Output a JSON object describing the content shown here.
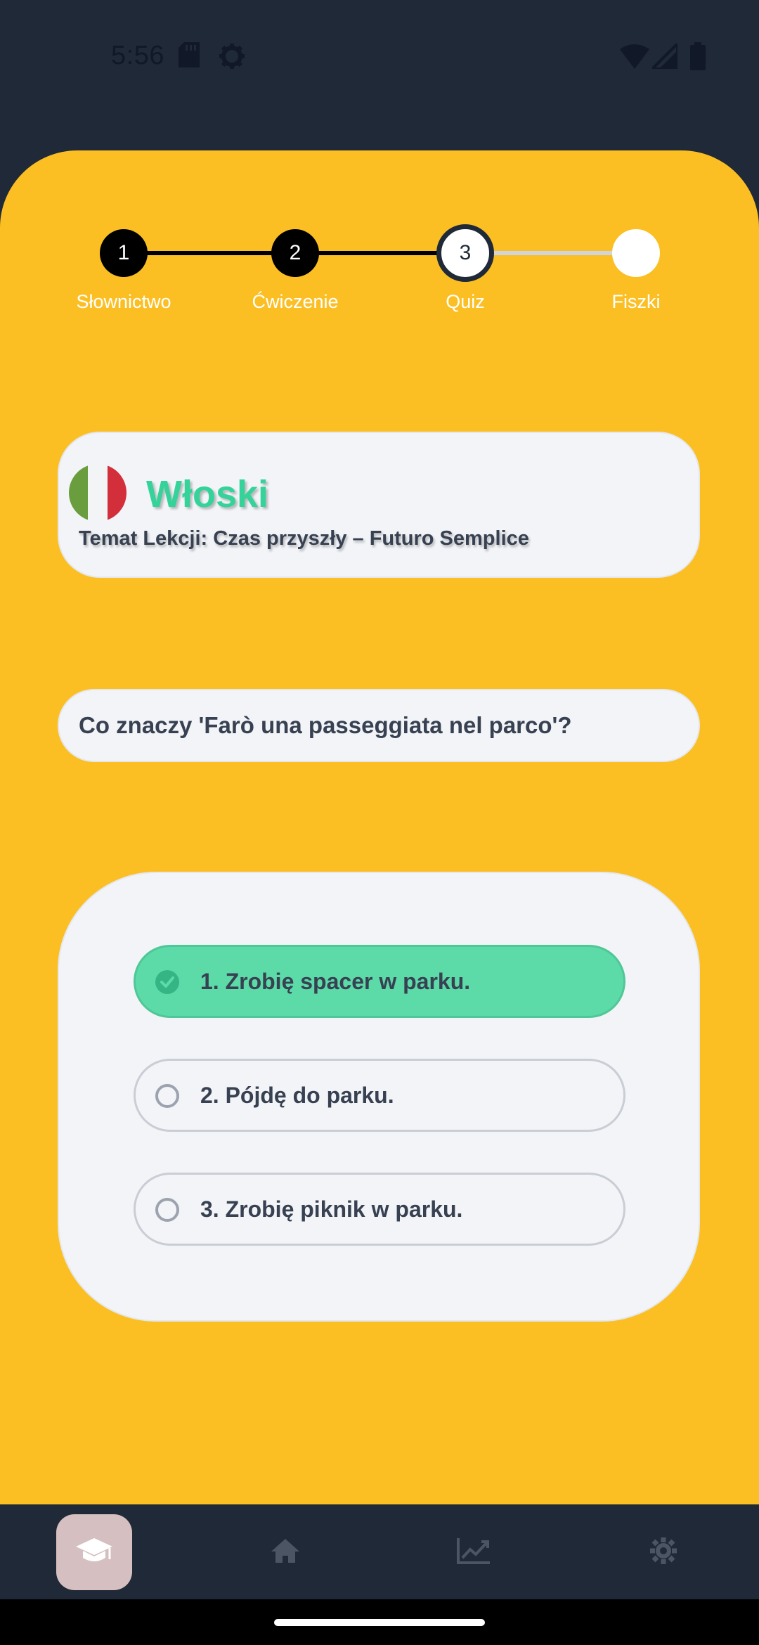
{
  "status_bar": {
    "time": "5:56",
    "icons_left": [
      "sd-card-icon",
      "settings-gear-icon"
    ],
    "icons_right": [
      "wifi-icon",
      "signal-icon",
      "battery-icon"
    ]
  },
  "stepper": {
    "steps": [
      {
        "number": "1",
        "label": "Słownictwo",
        "state": "done"
      },
      {
        "number": "2",
        "label": "Ćwiczenie",
        "state": "done"
      },
      {
        "number": "3",
        "label": "Quiz",
        "state": "current"
      },
      {
        "number": "",
        "label": "Fiszki",
        "state": "todo"
      }
    ]
  },
  "lesson": {
    "flag": "italy-flag-icon",
    "language": "Włoski",
    "topic": "Temat Lekcji: Czas przyszły – Futuro Semplice"
  },
  "question": {
    "text": "Co znaczy 'Farò una passeggiata nel parco'?"
  },
  "answers": [
    {
      "text": "1. Zrobię spacer w parku.",
      "selected": true
    },
    {
      "text": "2. Pójdę do parku.",
      "selected": false
    },
    {
      "text": "3. Zrobię piknik w parku.",
      "selected": false
    }
  ],
  "bottom_nav": {
    "items": [
      {
        "icon": "graduation-cap-icon",
        "active": true
      },
      {
        "icon": "home-icon",
        "active": false
      },
      {
        "icon": "chart-line-icon",
        "active": false
      },
      {
        "icon": "gear-icon",
        "active": false
      }
    ]
  },
  "colors": {
    "panel": "#fbbf24",
    "dark": "#1f2937",
    "accent_green": "#34d399",
    "selected_answer": "#5cdba9"
  }
}
